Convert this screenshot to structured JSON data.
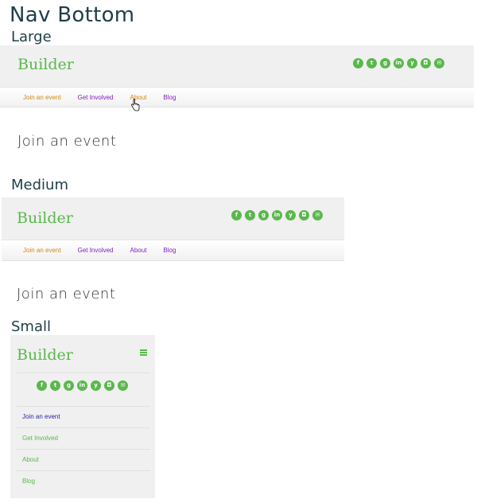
{
  "page_title": "Nav Bottom",
  "colors": {
    "brand_green": "#5ab84c",
    "active_orange": "#d4870f",
    "link_purple": "#8421c2",
    "heading": "#1e3e4a"
  },
  "social_icons": [
    {
      "name": "facebook-icon",
      "glyph": "f"
    },
    {
      "name": "twitter-icon",
      "glyph": "t"
    },
    {
      "name": "google-plus-icon",
      "glyph": "g"
    },
    {
      "name": "linkedin-icon",
      "glyph": "in"
    },
    {
      "name": "yelp-icon",
      "glyph": "y"
    },
    {
      "name": "instagram-icon",
      "glyph": "◘"
    },
    {
      "name": "email-icon",
      "glyph": "✉"
    }
  ],
  "large": {
    "label": "Large",
    "logo": "Builder",
    "nav": [
      "Join an event",
      "Get Involved",
      "About",
      "Blog"
    ],
    "heading": "Join an event"
  },
  "medium": {
    "label": "Medium",
    "logo": "Builder",
    "nav": [
      "Join an event",
      "Get Involved",
      "About",
      "Blog"
    ],
    "heading": "Join an event"
  },
  "small": {
    "label": "Small",
    "logo": "Builder",
    "menu_icon": "hamburger-icon",
    "nav": [
      "Join an event",
      "Get Involved",
      "About",
      "Blog"
    ]
  }
}
